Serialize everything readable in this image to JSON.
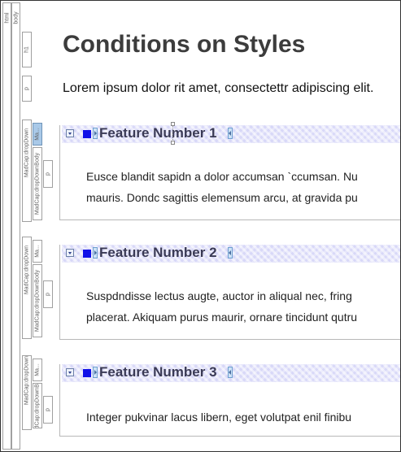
{
  "structure_bars": {
    "html": "html",
    "body": "body",
    "h1": "h1",
    "p": "p",
    "dropdown": "MadCap:dropDown",
    "dropdown_head": "MadCap:dropDownHead",
    "dropdown_body": "MadCap:dropDownBody",
    "hotspot_short": "Ma..."
  },
  "page": {
    "title": "Conditions on Styles",
    "intro": "Lorem ipsum dolor rit amet, consectettr adipiscing elit."
  },
  "sections": [
    {
      "heading": "Feature Number 1",
      "lines": [
        "Eusce blandit sapidn a dolor accumsan `ccumsan. Nu",
        "mauris. Dondc sagittis elemensum arcu, at gravida pu"
      ]
    },
    {
      "heading": "Feature Number 2",
      "lines": [
        "Suspdndisse lectus augte, auctor in aliqual nec, fring",
        "placerat. Akiquam purus maurir, ornare tincidunt qutru"
      ]
    },
    {
      "heading": "Feature Number 3",
      "lines": [
        "Integer pukvinar lacus libern, eget volutpat enil finibu"
      ]
    }
  ],
  "colors": {
    "hotspot_bg": "#d8d8f8",
    "condition_marker": "#1010e8",
    "selected_bar": "#a9c9e8"
  }
}
